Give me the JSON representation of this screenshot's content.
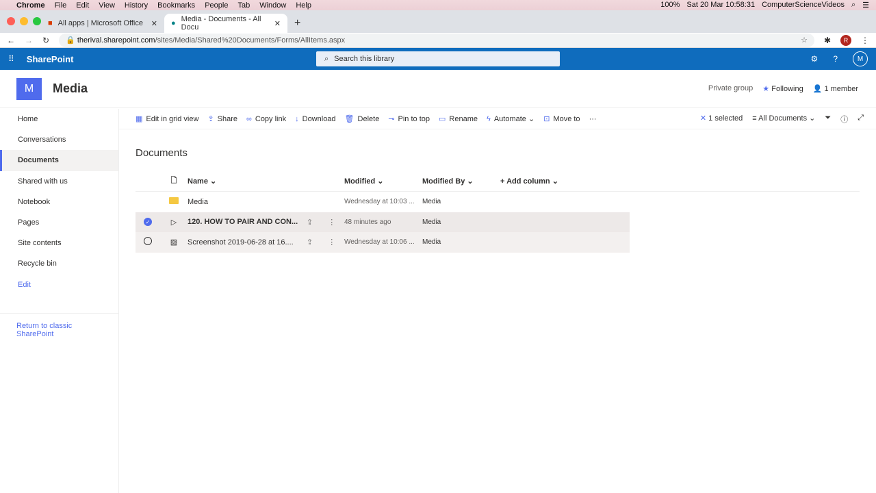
{
  "mac": {
    "app": "Chrome",
    "menus": [
      "File",
      "Edit",
      "View",
      "History",
      "Bookmarks",
      "People",
      "Tab",
      "Window",
      "Help"
    ],
    "battery": "100%",
    "datetime": "Sat 20 Mar  10:58:31",
    "user": "ComputerScienceVideos"
  },
  "browser": {
    "tabs": [
      {
        "title": "All apps | Microsoft Office"
      },
      {
        "title": "Media - Documents - All Docu"
      }
    ],
    "url_host": "therival.sharepoint.com",
    "url_path": "/sites/Media/Shared%20Documents/Forms/AllItems.aspx",
    "profile": "R"
  },
  "suite": {
    "brand": "SharePoint",
    "search_placeholder": "Search this library",
    "user_initial": "M"
  },
  "site": {
    "logo": "M",
    "name": "Media",
    "privacy": "Private group",
    "following": "Following",
    "members": "1 member"
  },
  "nav": {
    "items": [
      "Home",
      "Conversations",
      "Documents",
      "Shared with us",
      "Notebook",
      "Pages",
      "Site contents",
      "Recycle bin"
    ],
    "edit": "Edit",
    "classic": "Return to classic SharePoint"
  },
  "commands": {
    "items": [
      "Edit in grid view",
      "Share",
      "Copy link",
      "Download",
      "Delete",
      "Pin to top",
      "Rename",
      "Automate",
      "Move to"
    ],
    "selected": "1 selected",
    "view": "All Documents"
  },
  "library": {
    "title": "Documents",
    "columns": {
      "name": "Name",
      "modified": "Modified",
      "modified_by": "Modified By",
      "add": "Add column"
    },
    "rows": [
      {
        "name": "Media",
        "modified": "Wednesday at 10:03 ...",
        "by": "Media",
        "type": "folder",
        "selected": false
      },
      {
        "name": "120. HOW TO PAIR AND CON...",
        "modified": "48 minutes ago",
        "by": "Media",
        "type": "video",
        "selected": true
      },
      {
        "name": "Screenshot 2019-06-28 at 16....",
        "modified": "Wednesday at 10:06 ...",
        "by": "Media",
        "type": "image",
        "selected": false
      }
    ]
  },
  "colors": {
    "suite": "#0f6cbd",
    "accent": "#4f6bed"
  }
}
